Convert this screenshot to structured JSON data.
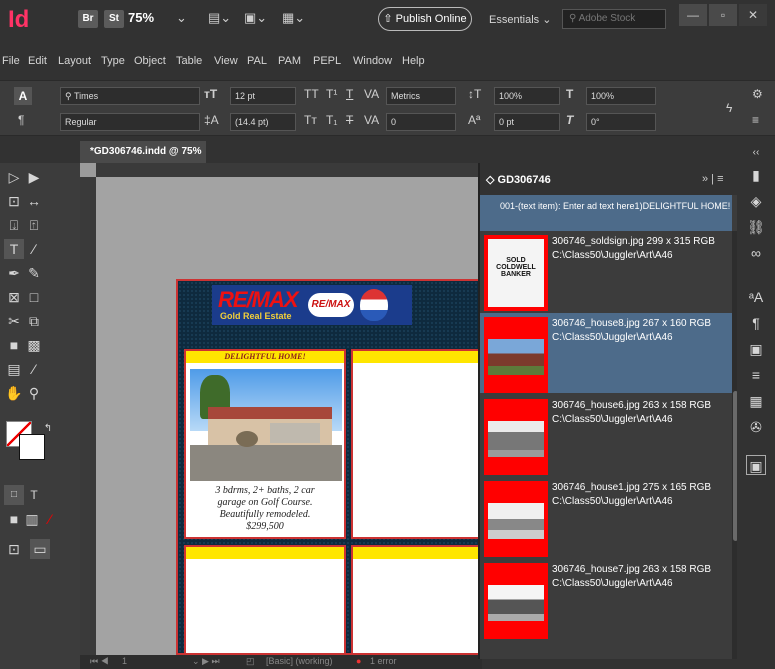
{
  "titlebar": {
    "app_icon": "Id",
    "bridge": "Br",
    "stock": "St",
    "zoom": "75%",
    "publish": "Publish Online",
    "workspace": "Essentials",
    "search_placeholder": "Adobe Stock"
  },
  "menu": [
    "File",
    "Edit",
    "Layout",
    "Type",
    "Object",
    "Table",
    "View",
    "PAL",
    "PAM",
    "PEPL",
    "Window",
    "Help"
  ],
  "control": {
    "font_family": "Times",
    "font_style": "Regular",
    "font_size": "12 pt",
    "leading": "(14.4 pt)",
    "kerning": "Metrics",
    "tracking": "0",
    "vscale": "100%",
    "hscale": "100%",
    "baseline": "0 pt",
    "skew": "0°"
  },
  "document_tab": "*GD306746.indd @ 75%",
  "status": {
    "page": "1",
    "preflight_profile": "[Basic] (working)",
    "errors": "1 error"
  },
  "layout": {
    "card1_head": "DELIGHTFUL HOME!",
    "card1_line1": "3 bdrms, 2+ baths, 2 car",
    "card1_line2": "garage on Golf Course.",
    "card1_line3": "Beautifully remodeled.",
    "card1_price": "$299,500",
    "logo_text": "RE/MAX",
    "logo_sub": "Gold Real Estate"
  },
  "panel": {
    "title": "GD306746",
    "info": "001-(text item): Enter ad text here1)DELIGHTFUL HOME!",
    "items": [
      {
        "name": "306746_soldsign.jpg 299 x 315 RGB",
        "path": "C:\\Class50\\Juggler\\Art\\A46"
      },
      {
        "name": "306746_house8.jpg 267 x 160 RGB",
        "path": "C:\\Class50\\Juggler\\Art\\A46"
      },
      {
        "name": "306746_house6.jpg 263 x 158 RGB",
        "path": "C:\\Class50\\Juggler\\Art\\A46"
      },
      {
        "name": "306746_house1.jpg 275 x 165 RGB",
        "path": "C:\\Class50\\Juggler\\Art\\A46"
      },
      {
        "name": "306746_house7.jpg 263 x 158 RGB",
        "path": "C:\\Class50\\Juggler\\Art\\A46"
      }
    ]
  },
  "colors": {
    "accent_selected": "#4d6b8a",
    "indesign_pink": "#ff3366",
    "thumb_border": "#ff0000"
  }
}
